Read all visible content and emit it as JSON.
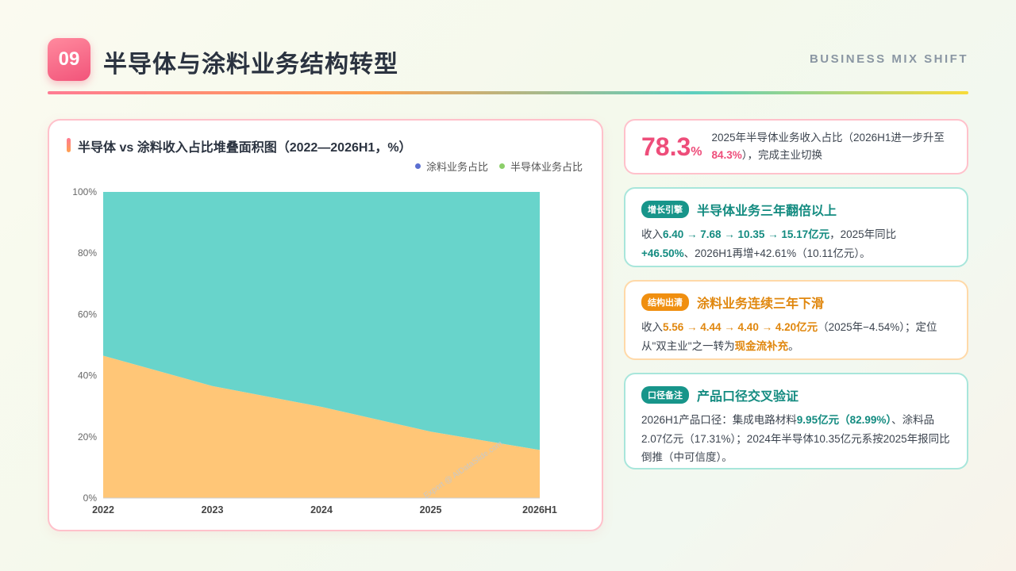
{
  "header": {
    "number": "09",
    "title": "半导体与涂料业务结构转型",
    "eyebrow": "BUSINESS MIX SHIFT"
  },
  "chart_card": {
    "title": "半导体 vs 涂料收入占比堆叠面积图（2022—2026H1，%）",
    "watermark": "Export @ AIDataSlide.com"
  },
  "chart_data": {
    "type": "area",
    "stacked": true,
    "categories": [
      "2022",
      "2023",
      "2024",
      "2025",
      "2026H1"
    ],
    "series": [
      {
        "name": "涂料业务占比",
        "values": [
          46.5,
          36.6,
          29.8,
          21.7,
          15.7
        ],
        "color": "#ffc677",
        "legend_color": "#5b6fd1"
      },
      {
        "name": "半导体业务占比",
        "values": [
          53.5,
          63.4,
          70.2,
          78.3,
          84.3
        ],
        "color": "#68d4cb",
        "legend_color": "#8ccf6a"
      }
    ],
    "ylim": [
      0,
      100
    ],
    "yticks": [
      "0%",
      "20%",
      "40%",
      "60%",
      "80%",
      "100%"
    ],
    "legend_position": "top-right",
    "grid": false
  },
  "kpi": {
    "value": "78.3",
    "unit": "%",
    "text_before": "2025年半导体业务收入占比（2026H1进一步升至",
    "text_highlight": "84.3%",
    "text_after": "），完成主业切换"
  },
  "growth": {
    "tag": "增长引擎",
    "title": "半导体业务三年翻倍以上",
    "p1": "收入",
    "h1": "6.40 → 7.68 → 10.35 → 15.17亿元",
    "p2": "，2025年同比",
    "h2": "+46.50%",
    "p3": "、2026H1再增+42.61%（10.11亿元）。"
  },
  "structure": {
    "tag": "结构出清",
    "title": "涂料业务连续三年下滑",
    "p1": "收入",
    "h1": "5.56 → 4.44 → 4.40 → 4.20亿元",
    "p2": "（2025年−4.54%）；定位从\"双主业\"之一转为",
    "h2": "现金流补充",
    "p3": "。"
  },
  "note": {
    "tag": "口径备注",
    "title": "产品口径交叉验证",
    "p1": "2026H1产品口径：集成电路材料",
    "h1": "9.95亿元（82.99%）",
    "p2": "、涂料品2.07亿元（17.31%）；2024年半导体10.35亿元系按2025年报同比倒推（中可信度）。"
  },
  "colors": {
    "accent_pink": "#ee4d7a",
    "accent_teal": "#138b80",
    "accent_orange": "#e0870e"
  }
}
